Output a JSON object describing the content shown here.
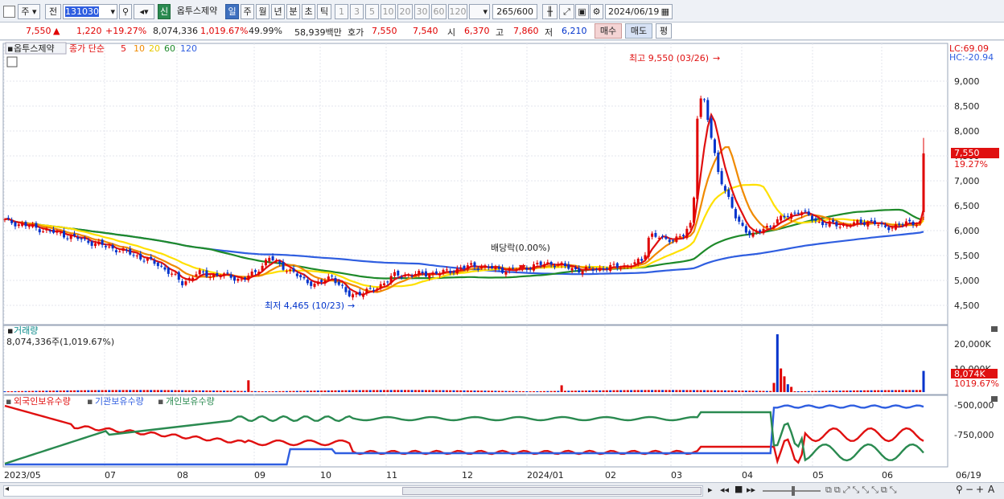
{
  "toolbar": {
    "market": "주",
    "prev": "전",
    "code": "131030",
    "new_label": "신",
    "stock_name": "옵투스제약",
    "periods": [
      "일",
      "주",
      "월",
      "년",
      "분",
      "초",
      "틱"
    ],
    "intervals": [
      "1",
      "3",
      "5",
      "10",
      "20",
      "30",
      "60",
      "120"
    ],
    "count": "265",
    "count_total": "/600",
    "date": "2024/06/19"
  },
  "quote": {
    "price": "7,550",
    "arrow": "▲",
    "change": "1,220",
    "change_pct": "+19.27%",
    "volume": "8,074,336",
    "volume_pct": "1,019.67%",
    "rate": "49.99%",
    "amount": "58,939백만",
    "hoga_label": "호가",
    "ask": "7,550",
    "bid": "7,540",
    "open_label": "시",
    "open": "6,370",
    "high_label": "고",
    "high": "7,860",
    "low_label": "저",
    "low": "6,210",
    "buy": "매수",
    "sell": "매도",
    "avg": "평"
  },
  "colors": {
    "up": "#e00000",
    "down": "#0033cc",
    "ma5": "#e01010",
    "ma10": "#f08a00",
    "ma20": "#ffe000",
    "ma60": "#1e8a2a",
    "ma120": "#2f5ee0",
    "foreign": "#e01010",
    "institution": "#2f5ee0",
    "individual": "#2a8a50"
  },
  "price_panel": {
    "stock_tag": "옵투스제약",
    "ma_label": "종가 단순",
    "ma_periods": [
      "5",
      "10",
      "20",
      "60",
      "120"
    ],
    "lc": "LC:69.09",
    "hc": "HC:-20.94",
    "y_ticks": [
      "9,000",
      "8,500",
      "8,000",
      "7,500",
      "7,000",
      "6,500",
      "6,000",
      "5,500",
      "5,000",
      "4,500"
    ],
    "last_price_tag": "7,550",
    "last_pct_tag": "19.27%",
    "annotation_high": "최고 9,550 (03/26)",
    "annotation_low": "최저 4,465 (10/23)",
    "annotation_dividend": "배당락(0.00%)"
  },
  "volume_panel": {
    "title": "거래량",
    "value": "8,074,336주(1,019.67%)",
    "y_tick": "20,000K",
    "y_tick2": "10,000K",
    "last_tag": "8,074K",
    "last_pct": "1019.67%"
  },
  "holdings_panel": {
    "legend": [
      "외국인보유수량",
      "기관보유수량",
      "개인보유수량"
    ],
    "y_ticks": [
      "-500,000",
      "-750,000"
    ]
  },
  "x_axis": [
    "2023/05",
    "07",
    "08",
    "09",
    "10",
    "11",
    "12",
    "2024/01",
    "02",
    "03",
    "04",
    "05",
    "06",
    "06/19"
  ]
}
